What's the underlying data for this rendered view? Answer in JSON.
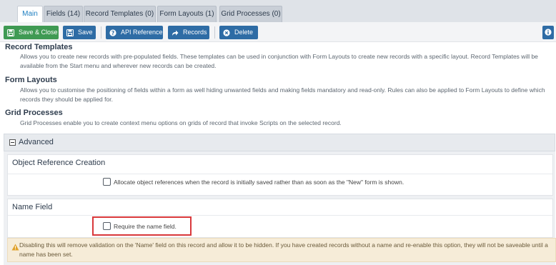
{
  "tabs": [
    {
      "label": "Main",
      "active": true
    },
    {
      "label": "Fields (14)",
      "active": false
    },
    {
      "label": "Record Templates (0)",
      "active": false
    },
    {
      "label": "Form Layouts (1)",
      "active": false
    },
    {
      "label": "Grid Processes (0)",
      "active": false
    }
  ],
  "toolbar": {
    "save_close_label": "Save & Close",
    "save_label": "Save",
    "api_reference_label": "API Reference",
    "records_label": "Records",
    "delete_label": "Delete"
  },
  "sections": {
    "record_templates": {
      "title": "Record Templates",
      "text": "Allows you to create new records with pre-populated fields. These templates can be used in conjunction with Form Layouts to create new records with a specific layout. Record Templates will be available from the Start menu and wherever new records can be created."
    },
    "form_layouts": {
      "title": "Form Layouts",
      "text": "Allows you to customise the positioning of fields within a form as well hiding unwanted fields and making fields mandatory and read-only. Rules can also be applied to Form Layouts to define which records they should be applied for."
    },
    "grid_processes": {
      "title": "Grid Processes",
      "text": "Grid Processes enable you to create context menu options on grids of record that invoke Scripts on the selected record."
    }
  },
  "advanced": {
    "title": "Advanced",
    "object_reference": {
      "title": "Object Reference Creation",
      "checkbox_label": "Allocate object references when the record is initially saved rather than as soon as the \"New\" form is shown.",
      "checked": false
    },
    "name_field": {
      "title": "Name Field",
      "checkbox_label": "Require the name field.",
      "checked": false,
      "warning": "Disabling this will remove validation on the 'Name' field on this record and allow it to be hidden. If you have created records without a name and re-enable this option, they will not be saveable until a name has been set."
    }
  },
  "colors": {
    "accent_blue": "#2e6ca5",
    "save_green": "#3f9a53",
    "highlight_red": "#d9383b",
    "warning_bg": "#f6ecd8"
  },
  "icons": {
    "save_close": "save-icon",
    "save": "save-icon",
    "api_reference": "question-circle-icon",
    "records": "share-arrow-icon",
    "delete": "close-circle-icon",
    "info": "info-icon",
    "warning": "warning-triangle-icon",
    "collapse": "minus-square-icon"
  }
}
